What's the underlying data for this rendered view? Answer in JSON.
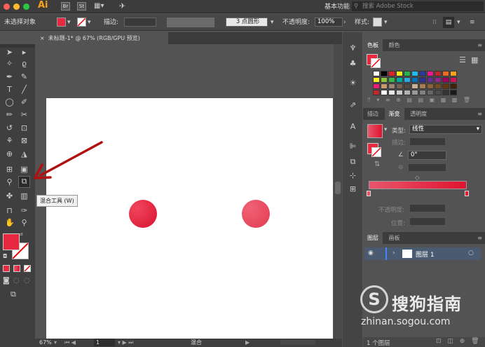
{
  "titlebar": {
    "app_icon": "Ai",
    "workspace": "基本功能",
    "search_placeholder": "搜索 Adobe Stock",
    "app_icons": [
      "Br",
      "St"
    ]
  },
  "controlbar": {
    "selection_label": "未选择对象",
    "stroke_label": "描边:",
    "brush_label": "3 点圆形",
    "opacity_label": "不透明度:",
    "opacity_value": "100%",
    "style_label": "样式:"
  },
  "document": {
    "tab_title": "未标题-1* @ 67% (RGB/GPU 预览)",
    "close": "×"
  },
  "tooltip": {
    "text": "混合工具 (W)"
  },
  "status": {
    "zoom": "67%",
    "page": "1",
    "tool": "混合"
  },
  "colors": {
    "accent_red": "#e8283f",
    "circle_left": "#e21d3a",
    "circle_right": "#e9485c",
    "panel_bg": "#535353"
  },
  "swatches": {
    "tabs": [
      "色板",
      "颜色"
    ],
    "rows": [
      [
        "#ffffff",
        "#000000",
        "#e32128",
        "#f7ed1b",
        "#27b34a",
        "#28b9ec",
        "#2e3a93",
        "#ea1a8e",
        "#c1272d",
        "#ec6b24",
        "#f7a21a"
      ],
      [
        "#fcee21",
        "#8cc63f",
        "#39b54a",
        "#00a99d",
        "#29abe2",
        "#0071bc",
        "#2e3192",
        "#662d91",
        "#93278f",
        "#9e005d",
        "#d4145a"
      ],
      [
        "#ed1e79",
        "#c69c6d",
        "#998675",
        "#736357",
        "#534741",
        "#c7b299",
        "#a67c52",
        "#8c6239",
        "#754c24",
        "#603813",
        "#42210b"
      ],
      [
        "#c1272d",
        "#ffffff",
        "#e6e6e6",
        "#cccccc",
        "#b3b3b3",
        "#999999",
        "#808080",
        "#666666",
        "#4d4d4d",
        "#333333",
        "#1a1a1a"
      ]
    ]
  },
  "gradient": {
    "tabs": [
      "描边",
      "渐变",
      "透明度"
    ],
    "type_label": "类型:",
    "type_value": "线性",
    "stroke_label": "描边:",
    "angle_value": "0°",
    "opacity_label": "不透明度:",
    "position_label": "位置:",
    "start_color": "#e8566b",
    "end_color": "#e0132f"
  },
  "layers": {
    "tabs": [
      "图层",
      "画板"
    ],
    "layer_name": "图层 1",
    "count": "1 个图层"
  },
  "watermark": {
    "brand": "搜狗指南",
    "url": "zhinan.sogou.com"
  }
}
